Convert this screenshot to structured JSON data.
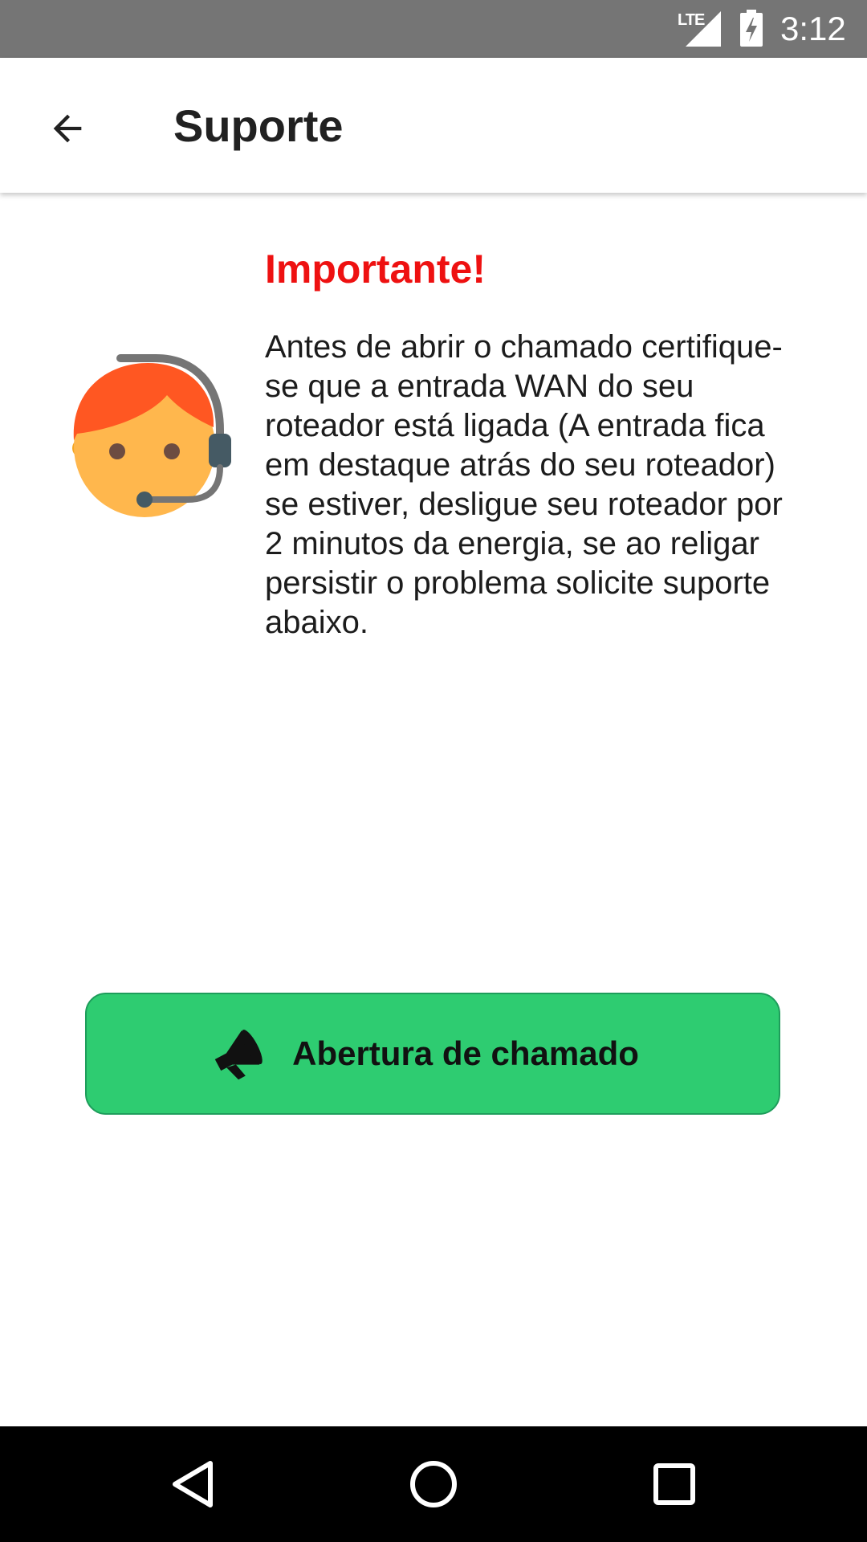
{
  "status_bar": {
    "network_label": "LTE",
    "time": "3:12",
    "icons": [
      "signal-icon",
      "battery-charging-icon"
    ]
  },
  "app_bar": {
    "title": "Suporte",
    "back_icon": "arrow-back-icon"
  },
  "notice": {
    "heading": "Importante!",
    "body": "Antes de abrir o chamado certifique-\nse que a entrada WAN do seu\nroteador está ligada (A entrada fica\nem destaque atrás do seu roteador)\nse estiver, desligue seu roteador por\n2 minutos da energia, se ao religar\npersistir o problema solicite suporte\nabaixo.",
    "illustration_icon": "support-agent-headset-icon"
  },
  "open_ticket_button": {
    "label": "Abertura de chamado",
    "icon": "megaphone-icon"
  },
  "nav_bar": {
    "icons": [
      "nav-back-icon",
      "nav-home-icon",
      "nav-recents-icon"
    ]
  },
  "colors": {
    "status_bar": "#757575",
    "heading_red": "#ee1111",
    "button_green": "#2ecc71",
    "button_border": "#1e9d5b",
    "nav_bar": "#000000"
  }
}
